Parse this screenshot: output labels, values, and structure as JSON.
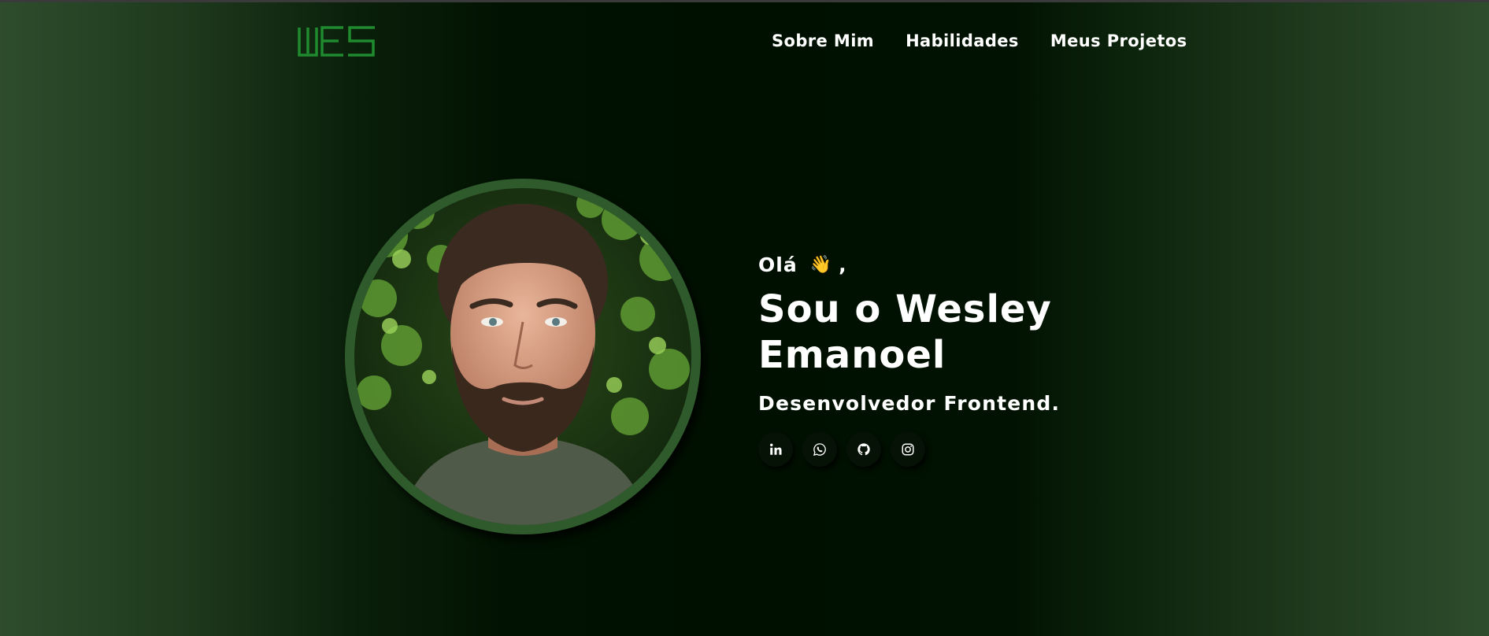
{
  "header": {
    "logo_text": "WES",
    "nav": [
      {
        "label": "Sobre Mim"
      },
      {
        "label": "Habilidades"
      },
      {
        "label": "Meus Projetos"
      }
    ]
  },
  "hero": {
    "greeting": "Olá",
    "greeting_emoji": "👋",
    "greeting_suffix": ",",
    "title_line1": "Sou o Wesley",
    "title_line2": "Emanoel",
    "subtitle": "Desenvolvedor Frontend.",
    "photo_icon": "profile-photo",
    "socials": [
      {
        "icon": "linkedin-icon"
      },
      {
        "icon": "whatsapp-icon"
      },
      {
        "icon": "github-icon"
      },
      {
        "icon": "instagram-icon"
      }
    ]
  },
  "colors": {
    "logo_green": "#1f8a2e",
    "photo_ring": "#2f5a2c",
    "background_center": "#001000",
    "background_edge": "#2e4d2c"
  }
}
